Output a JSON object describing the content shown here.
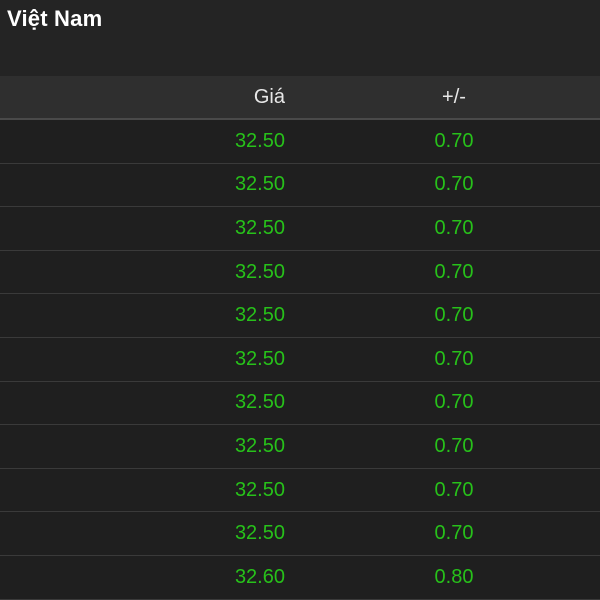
{
  "header": {
    "title": "Việt Nam"
  },
  "table": {
    "columns": {
      "price": "Giá",
      "change": "+/-"
    },
    "rows": [
      {
        "price": "32.50",
        "change": "0.70"
      },
      {
        "price": "32.50",
        "change": "0.70"
      },
      {
        "price": "32.50",
        "change": "0.70"
      },
      {
        "price": "32.50",
        "change": "0.70"
      },
      {
        "price": "32.50",
        "change": "0.70"
      },
      {
        "price": "32.50",
        "change": "0.70"
      },
      {
        "price": "32.50",
        "change": "0.70"
      },
      {
        "price": "32.50",
        "change": "0.70"
      },
      {
        "price": "32.50",
        "change": "0.70"
      },
      {
        "price": "32.50",
        "change": "0.70"
      },
      {
        "price": "32.60",
        "change": "0.80"
      }
    ]
  },
  "colors": {
    "background": "#1f1f1f",
    "header_bg": "#2f2f2f",
    "value_positive": "#27c11a",
    "divider": "#3a3a3a"
  }
}
